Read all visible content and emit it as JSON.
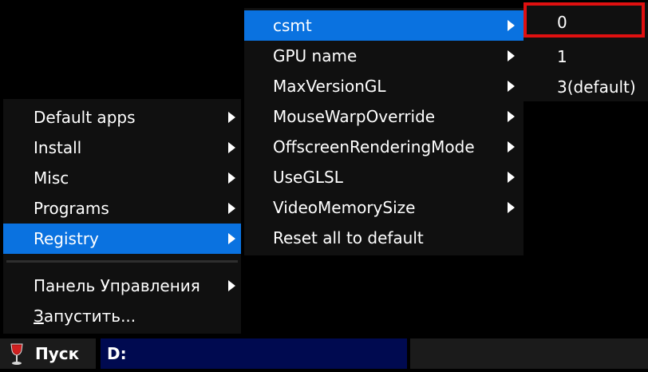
{
  "start_menu": {
    "items": [
      {
        "label": "Default apps"
      },
      {
        "label": "Install"
      },
      {
        "label": "Misc"
      },
      {
        "label": "Programs"
      },
      {
        "label": "Registry"
      }
    ],
    "control_panel_label": "Панель Управления",
    "run_label": "Запустить..."
  },
  "registry_menu": {
    "items": [
      {
        "label": "csmt"
      },
      {
        "label": "GPU name"
      },
      {
        "label": "MaxVersionGL"
      },
      {
        "label": "MouseWarpOverride"
      },
      {
        "label": "OffscreenRenderingMode"
      },
      {
        "label": "UseGLSL"
      },
      {
        "label": "VideoMemorySize"
      },
      {
        "label": "Reset all to default"
      }
    ]
  },
  "csmt_menu": {
    "items": [
      {
        "label": "0"
      },
      {
        "label": "1"
      },
      {
        "label": "3(default)"
      }
    ]
  },
  "taskbar": {
    "start_label": "Пуск",
    "start_icon": "wine-glass-icon",
    "task_label": "D:"
  },
  "colors": {
    "selection": "#0a72e0",
    "menu_background": "#101010",
    "task_active": "#000a50",
    "highlight_frame": "#e01010"
  }
}
